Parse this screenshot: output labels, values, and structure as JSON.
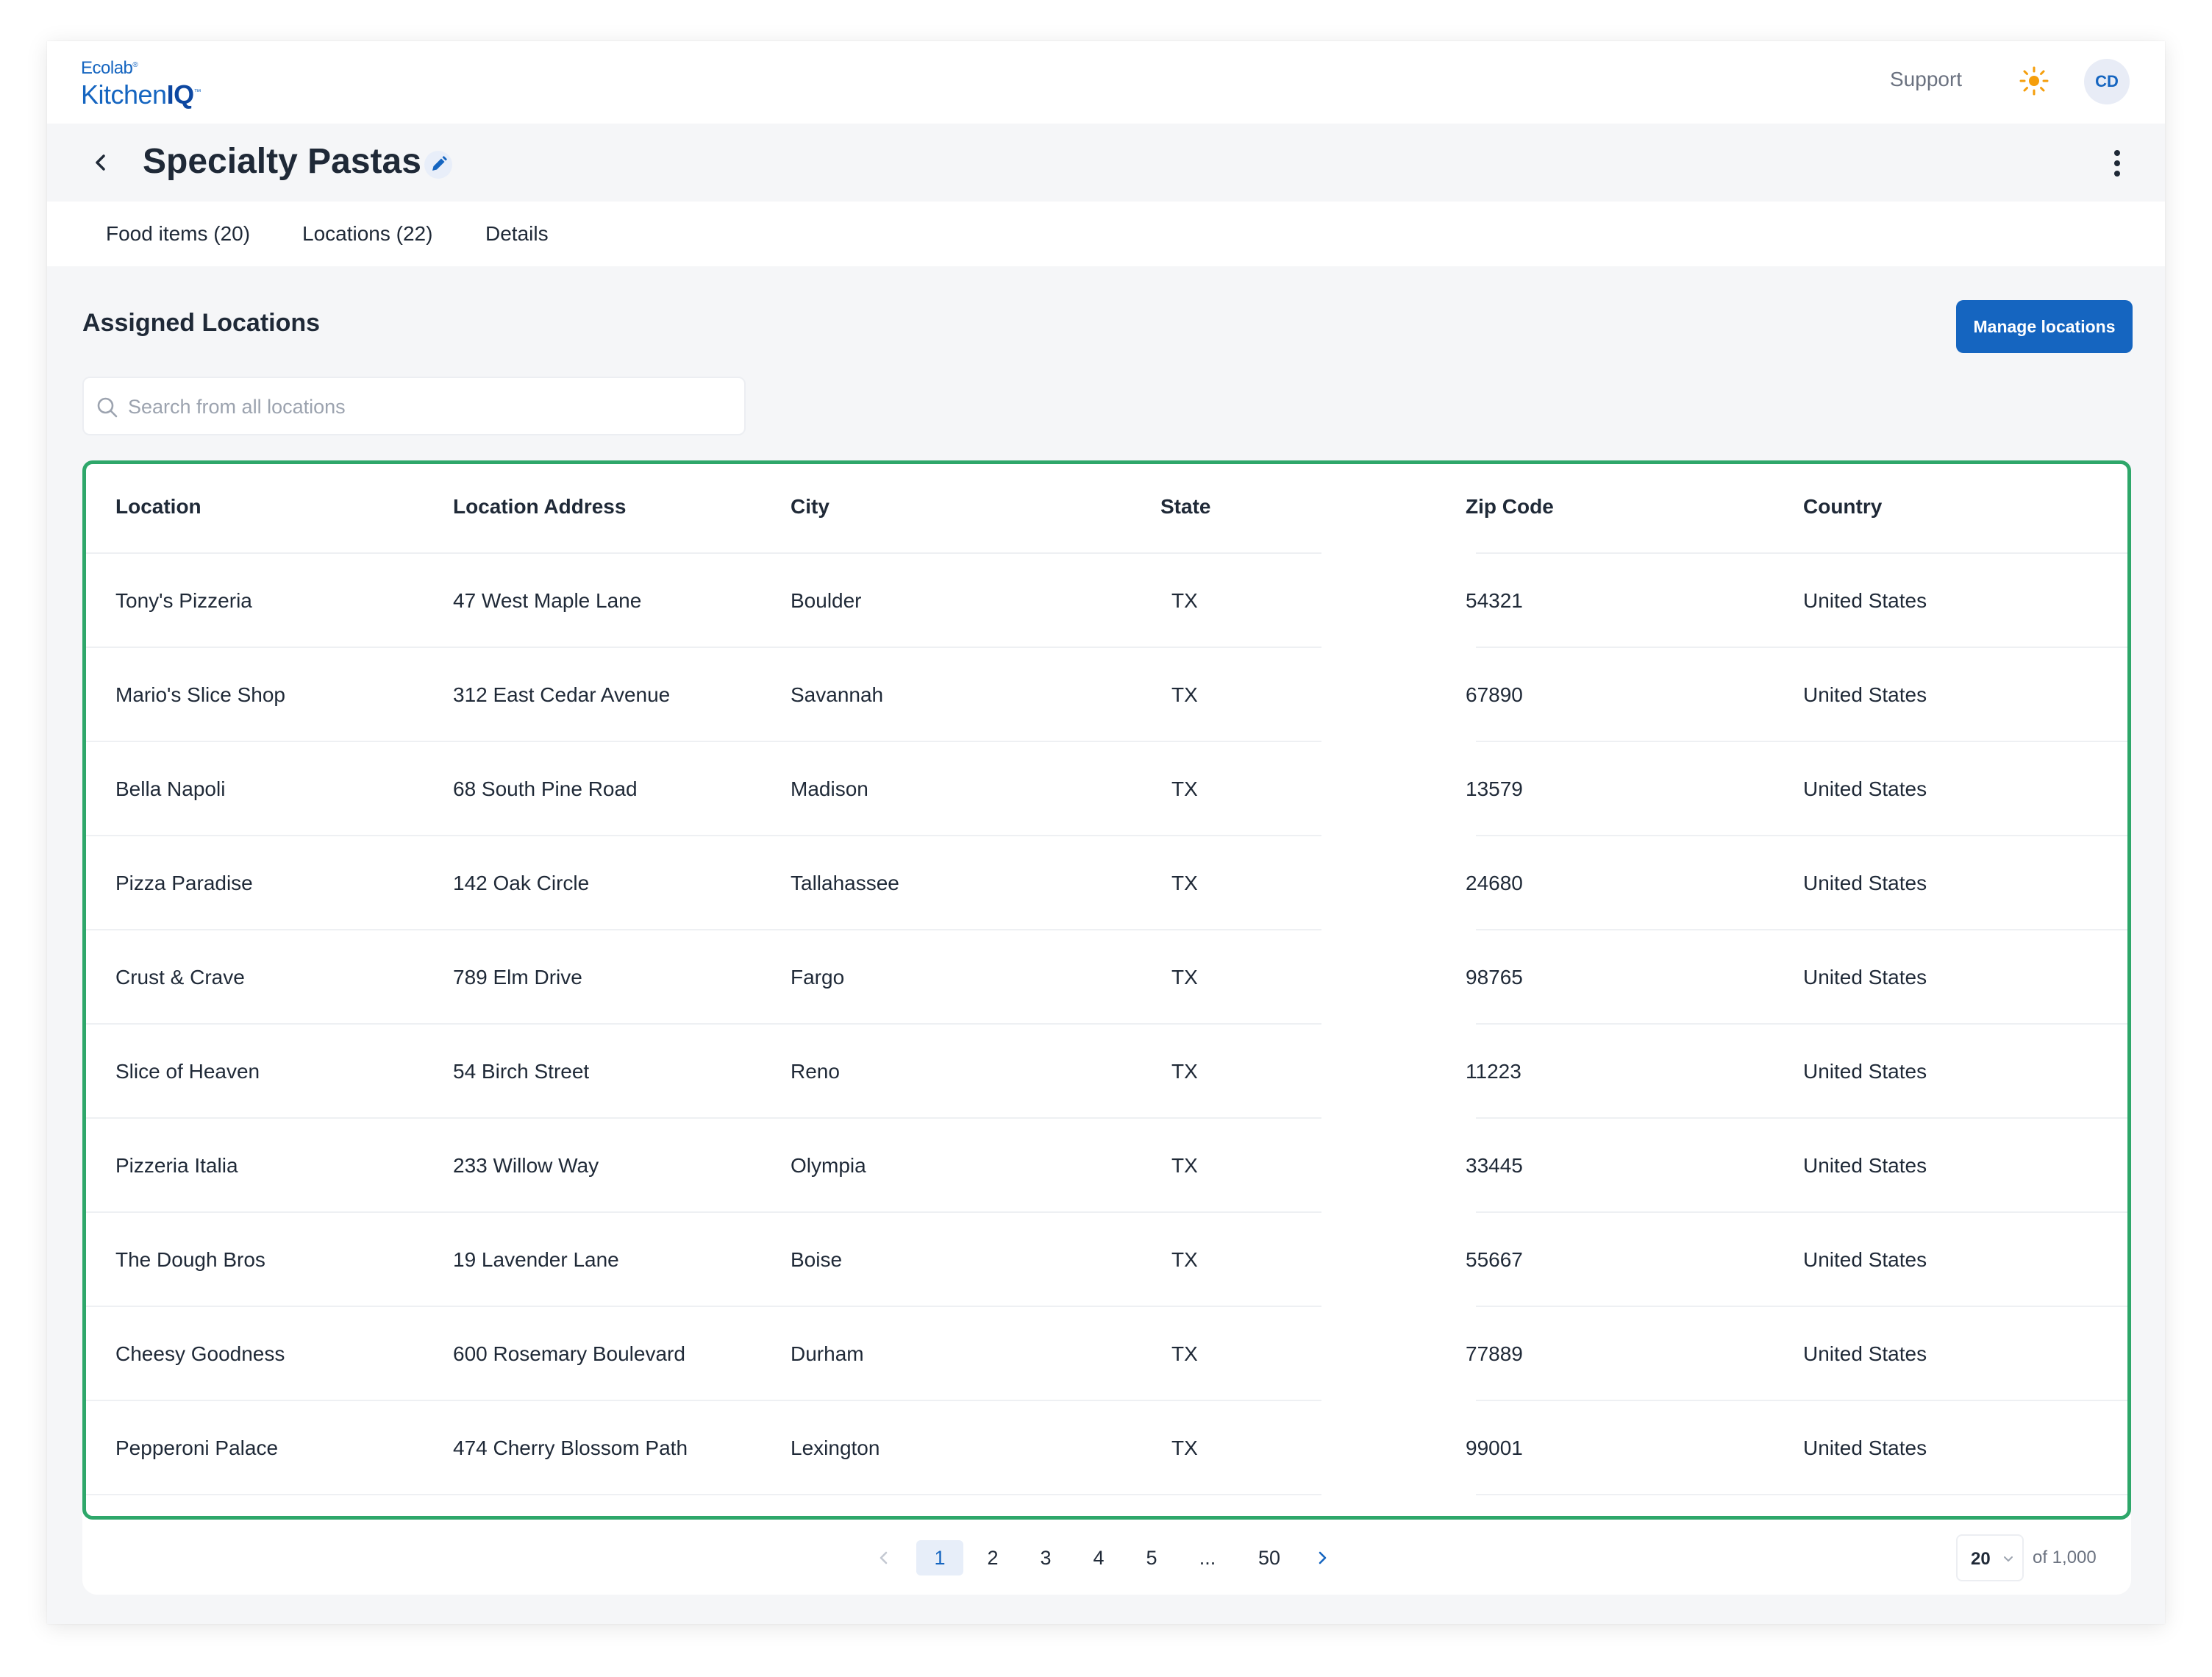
{
  "brand": {
    "line1": "Ecolab",
    "line1_mark": "®",
    "line2_prefix": "Kitchen",
    "line2_bold": "IQ",
    "line2_mark": "™"
  },
  "header": {
    "support_label": "Support",
    "theme_icon": "sun-icon",
    "avatar_initials": "CD"
  },
  "page": {
    "title": "Specialty Pastas",
    "back_icon": "chevron-left-icon",
    "edit_icon": "pencil-icon",
    "more_icon": "vertical-dots-icon"
  },
  "tabs": [
    {
      "label": "Food items (20)"
    },
    {
      "label": "Locations (22)"
    },
    {
      "label": "Details"
    }
  ],
  "section": {
    "title": "Assigned Locations",
    "manage_label": "Manage locations"
  },
  "search": {
    "placeholder": "Search from all locations",
    "value": ""
  },
  "table": {
    "columns": [
      "Location",
      "Location Address",
      "City",
      "State",
      "Zip Code",
      "Country"
    ],
    "rows": [
      [
        "Tony's Pizzeria",
        "47 West Maple Lane",
        "Boulder",
        "TX",
        "54321",
        "United States"
      ],
      [
        "Mario's Slice Shop",
        "312 East Cedar Avenue",
        "Savannah",
        "TX",
        "67890",
        "United States"
      ],
      [
        "Bella Napoli",
        "68 South Pine Road",
        "Madison",
        "TX",
        "13579",
        "United States"
      ],
      [
        "Pizza Paradise",
        "142 Oak Circle",
        "Tallahassee",
        "TX",
        "24680",
        "United States"
      ],
      [
        "Crust & Crave",
        "789 Elm Drive",
        "Fargo",
        "TX",
        "98765",
        "United States"
      ],
      [
        "Slice of Heaven",
        "54 Birch Street",
        "Reno",
        "TX",
        "11223",
        "United States"
      ],
      [
        "Pizzeria Italia",
        "233 Willow Way",
        "Olympia",
        "TX",
        "33445",
        "United States"
      ],
      [
        "The Dough Bros",
        "19 Lavender Lane",
        "Boise",
        "TX",
        "55667",
        "United States"
      ],
      [
        "Cheesy Goodness",
        "600 Rosemary Boulevard",
        "Durham",
        "TX",
        "77889",
        "United States"
      ],
      [
        "Pepperoni Palace",
        "474 Cherry Blossom Path",
        "Lexington",
        "TX",
        "99001",
        "United States"
      ]
    ]
  },
  "pagination": {
    "pages": [
      "1",
      "2",
      "3",
      "4",
      "5",
      "...",
      "50"
    ],
    "current": "1",
    "per_page": "20",
    "total_label": "of 1,000"
  },
  "colors": {
    "accent": "#1565c0",
    "table_border": "#2ea76a",
    "sun": "#f59e0b"
  }
}
